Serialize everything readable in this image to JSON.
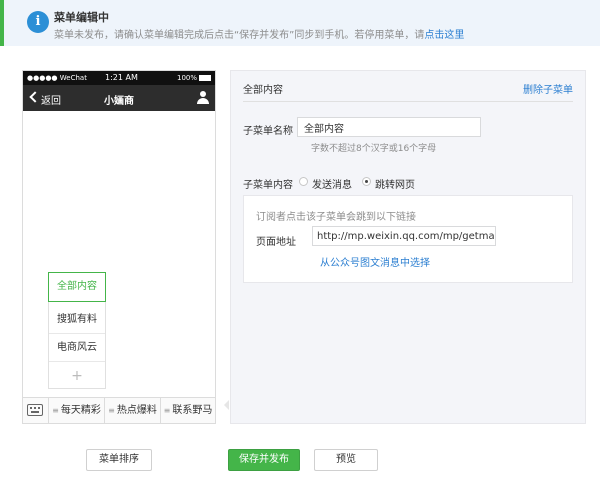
{
  "notice": {
    "icon": "info-icon",
    "icon_glyph": "i",
    "title": "菜单编辑中",
    "desc_text": "菜单未发布，请确认菜单编辑完成后点击“保存并发布”同步到手机。若停用菜单，请",
    "desc_link": "点击这里"
  },
  "phone": {
    "status": {
      "carrier": "●●●●● WeChat ",
      "time": "1:21 AM",
      "battery": "100%"
    },
    "nav": {
      "back_label": "返回",
      "title": "小婳商"
    },
    "submenu": {
      "items": [
        "全部内容",
        "搜狐有料",
        "电商风云"
      ],
      "add_glyph": "+"
    },
    "menu_tabs": [
      "每天精彩",
      "热点爆料",
      "联系野马"
    ]
  },
  "editor": {
    "title": "全部内容",
    "delete_link": "删除子菜单",
    "name_label": "子菜单名称",
    "name_value": "全部内容",
    "name_hint": "字数不超过8个汉字或16个字母",
    "content_label": "子菜单内容",
    "options": [
      "发送消息",
      "跳转网页"
    ],
    "selected_option": "跳转网页",
    "redirect": {
      "desc": "订阅者点击该子菜单会跳到以下链接",
      "url_label": "页面地址",
      "url_value": "http://mp.weixin.qq.com/mp/getmasss",
      "select_link": "从公众号图文消息中选择"
    }
  },
  "buttons": {
    "sort": "菜单排序",
    "save": "保存并发布",
    "preview": "预览"
  },
  "colors": {
    "accent_green": "#44b549",
    "link_blue": "#2c7fd1",
    "info_blue": "#2c8fd6"
  }
}
